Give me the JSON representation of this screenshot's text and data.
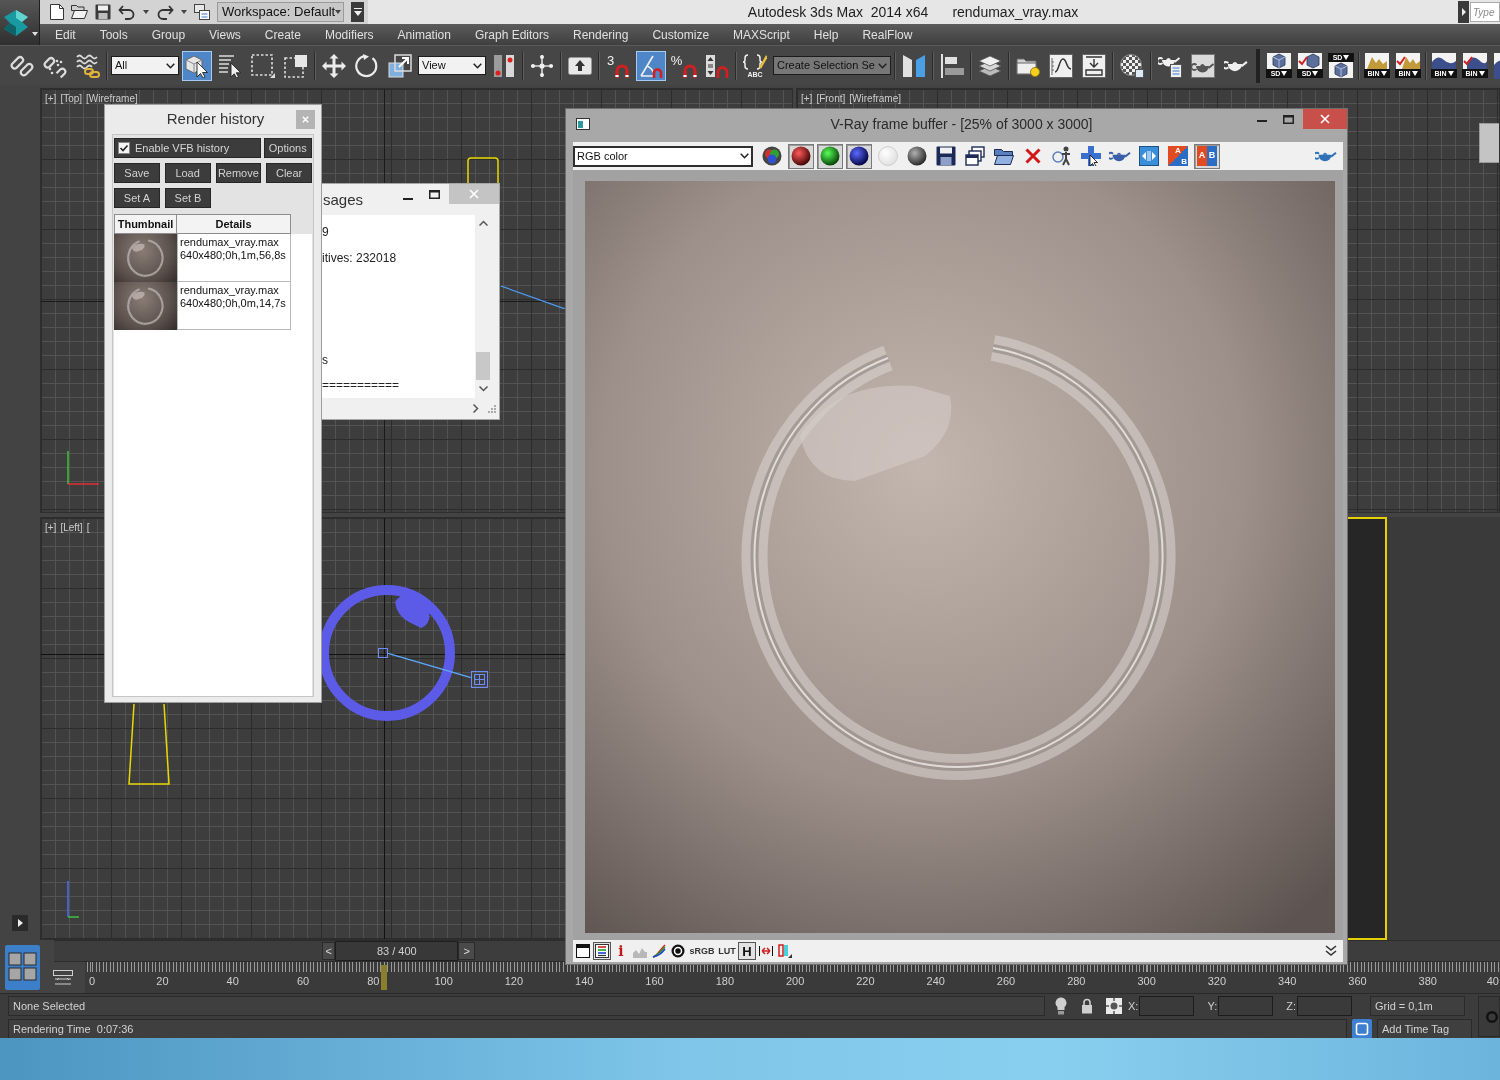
{
  "title_bar": {
    "quick_access": [
      {
        "kind": "new"
      },
      {
        "kind": "open"
      },
      {
        "kind": "save"
      },
      {
        "kind": "undo"
      },
      {
        "kind": "caret"
      },
      {
        "kind": "redo"
      },
      {
        "kind": "caret"
      },
      {
        "kind": "project"
      }
    ],
    "workspace": "Workspace: Default",
    "app_title": "Autodesk 3ds Max  2014 x64",
    "file_name": "rendumax_vray.max",
    "search": {
      "placeholder": "Type"
    }
  },
  "menu_bar": [
    "Edit",
    "Tools",
    "Group",
    "Views",
    "Create",
    "Modifiers",
    "Animation",
    "Graph Editors",
    "Rendering",
    "Customize",
    "MAXScript",
    "Help",
    "RealFlow"
  ],
  "main_toolbar": [
    [
      {
        "kind": "link",
        "on": false
      },
      {
        "kind": "unlink",
        "on": false
      },
      {
        "kind": "bind",
        "on": false
      }
    ],
    [
      {
        "kind": "dropdown",
        "value": "All"
      },
      {
        "kind": "select",
        "on": true
      },
      {
        "kind": "select_by_name",
        "on": false
      },
      {
        "kind": "region",
        "on": false
      },
      {
        "kind": "crossing",
        "on": false
      }
    ],
    [
      {
        "kind": "move",
        "on": false
      },
      {
        "kind": "rotate",
        "on": false
      },
      {
        "kind": "scale",
        "on": false
      },
      {
        "kind": "dropdown",
        "value": "View"
      },
      {
        "kind": "pivot",
        "on": false
      }
    ],
    [
      {
        "kind": "manipulate",
        "on": false
      }
    ],
    [
      {
        "kind": "keyboard",
        "on": false
      }
    ],
    [
      {
        "kind": "snap",
        "label": "3",
        "on": false
      },
      {
        "kind": "angle_snap",
        "on": true
      },
      {
        "kind": "percent_snap",
        "label": "%",
        "on": false
      },
      {
        "kind": "spinner_snap",
        "on": false
      }
    ],
    [
      {
        "kind": "named_sets",
        "label": "ABC",
        "on": false
      },
      {
        "kind": "combo",
        "value": "Create Selection Se"
      }
    ],
    [
      {
        "kind": "mirror",
        "on": false
      }
    ],
    [
      {
        "kind": "align",
        "on": false
      }
    ],
    [
      {
        "kind": "layers",
        "on": false
      }
    ],
    [
      {
        "kind": "explorer",
        "on": false
      },
      {
        "kind": "curve_editor",
        "on": false
      },
      {
        "kind": "schematic",
        "on": false
      }
    ],
    [
      {
        "kind": "material",
        "on": false
      }
    ],
    [
      {
        "kind": "render_setup",
        "on": false
      },
      {
        "kind": "frame_window",
        "on": false
      },
      {
        "kind": "render",
        "on": false
      }
    ]
  ],
  "vray_toolbar": [
    [
      {
        "kind": "cube_save",
        "label": "SD"
      },
      {
        "kind": "cube_check",
        "label": "SD"
      },
      {
        "kind": "cube_load",
        "label": "SD"
      }
    ],
    [
      {
        "kind": "texture_save",
        "label": "BIN"
      },
      {
        "kind": "texture_check",
        "label": "BIN"
      }
    ],
    [
      {
        "kind": "sphere_save",
        "label": "BIN"
      },
      {
        "kind": "sphere_check",
        "label": "BIN"
      },
      {
        "kind": "sphere_part"
      }
    ]
  ],
  "viewports": [
    {
      "kind": "grid",
      "labels": [
        "[+]",
        "[Top]",
        "[Wireframe]"
      ],
      "active": false
    },
    {
      "kind": "grid",
      "labels": [
        "[+]",
        "[Front]",
        "[Wireframe]"
      ],
      "active": false
    },
    {
      "kind": "grid",
      "labels": [
        "[+]",
        "[Left]",
        "["
      ],
      "active": false
    },
    {
      "kind": "shaded",
      "active": true
    }
  ],
  "render_history": {
    "title": "Render history",
    "history_toggle": {
      "label": "Enable VFB history",
      "checked": true
    },
    "options": "Options",
    "button_rows": [
      [
        "Save",
        "Load",
        "Remove",
        "Clear"
      ],
      [
        "Set A",
        "Set B"
      ]
    ],
    "columns": [
      "Thumbnail",
      "Details"
    ],
    "rows": [
      {
        "file": "rendumax_vray.max",
        "info": "640x480;0h,1m,56,8s"
      },
      {
        "file": "rendumax_vray.max",
        "info": "640x480;0h,0m,14,7s"
      }
    ]
  },
  "messages": {
    "title": "sages",
    "log": "9\nitives: 232018\n\n\n\ns\n==========="
  },
  "frame_buffer": {
    "title": "V-Ray frame buffer - [25% of 3000 x 3000]",
    "channel": "RGB color",
    "toolbar": [
      {
        "kind": "rgb",
        "on": false
      },
      {
        "kind": "red",
        "on": true
      },
      {
        "kind": "green",
        "on": true
      },
      {
        "kind": "blue",
        "on": true
      },
      {
        "kind": "alpha",
        "on": false
      },
      {
        "kind": "mono",
        "on": false
      },
      {
        "kind": "save",
        "on": false
      },
      {
        "kind": "duplicate",
        "on": false
      },
      {
        "kind": "open",
        "on": false
      },
      {
        "kind": "clear",
        "on": false
      },
      {
        "kind": "track",
        "on": false
      },
      {
        "kind": "region",
        "on": false
      },
      {
        "kind": "render",
        "on": false
      },
      {
        "kind": "link",
        "on": false
      },
      {
        "kind": "ab_diagonal",
        "labels": [
          "A",
          "B"
        ],
        "on": false
      },
      {
        "kind": "ab_side",
        "labels": [
          "A",
          "B"
        ],
        "on": true
      }
    ],
    "bottom_toolbar": [
      {
        "kind": "window",
        "on": false
      },
      {
        "kind": "levels",
        "on": true
      },
      {
        "kind": "info",
        "label": "i",
        "on": false
      },
      {
        "kind": "histogram",
        "on": false
      },
      {
        "kind": "curve",
        "on": false
      },
      {
        "kind": "lens",
        "on": false
      },
      {
        "kind": "srgb",
        "label": "sRGB",
        "on": false
      },
      {
        "kind": "lut",
        "label": "LUT",
        "on": false
      },
      {
        "kind": "h",
        "label": "H",
        "on": true
      },
      {
        "kind": "arrows",
        "on": false
      },
      {
        "kind": "compare",
        "on": false
      }
    ]
  },
  "timeline": {
    "prev": "<",
    "position": "83 / 400",
    "next": ">",
    "level": 0.2075,
    "ticks": [
      "0",
      "20",
      "40",
      "60",
      "80",
      "100",
      "120",
      "140",
      "160",
      "180",
      "200",
      "220",
      "240",
      "260",
      "280",
      "300",
      "320",
      "340",
      "360",
      "380",
      "40"
    ]
  },
  "status_bar": {
    "selection": "None Selected",
    "coordinates": [
      {
        "label": "X:"
      },
      {
        "label": "Y:"
      },
      {
        "label": "Z:"
      }
    ],
    "grid": "Grid = 0,1m",
    "prompt": "Rendering Time  0:07:36",
    "time_tag": "Add Time Tag"
  }
}
